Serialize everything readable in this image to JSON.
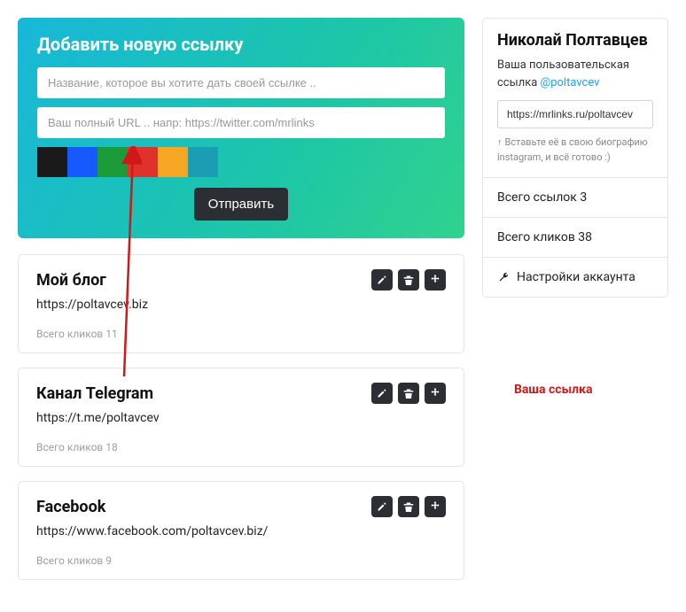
{
  "addForm": {
    "title": "Добавить новую ссылку",
    "name_placeholder": "Название, которое вы хотите дать своей ссылке ..",
    "url_placeholder": "Ваш полный URL .. напр: https://twitter.com/mrlinks",
    "colors": [
      "#1a1a1a",
      "#1559ff",
      "#1c9b3a",
      "#e0322c",
      "#f5a623",
      "#1b9db4"
    ],
    "submit_label": "Отправить"
  },
  "links": [
    {
      "title": "Мой блог",
      "url": "https://poltavcev.biz",
      "clicks_label": "Всего кликов 11"
    },
    {
      "title": "Канал Telegram",
      "url": "https://t.me/poltavcev",
      "clicks_label": "Всего кликов 18"
    },
    {
      "title": "Facebook",
      "url": "https://www.facebook.com/poltavcev.biz/",
      "clicks_label": "Всего кликов 9"
    }
  ],
  "profile": {
    "name": "Николай Полтавцев",
    "subtitle_prefix": "Ваша пользовательская ссылка ",
    "handle": "@poltavcev",
    "link_value": "https://mrlinks.ru/poltavcev",
    "hint": "Вставьте её в свою биографию instagram, и всё готово :)",
    "total_links": "Всего ссылок 3",
    "total_clicks": "Всего кликов 38",
    "settings_label": "Настройки аккаунта"
  },
  "annotation": {
    "label": "Ваша ссылка"
  }
}
